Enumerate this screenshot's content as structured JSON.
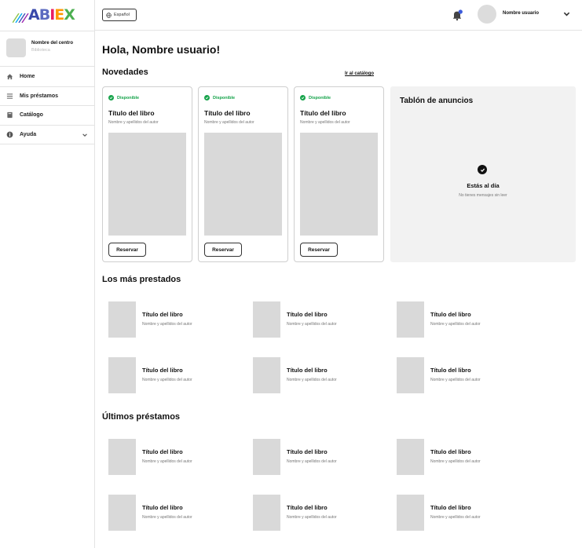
{
  "brand": {
    "logo_text": "ABIEX"
  },
  "center": {
    "name": "Nombre del centro",
    "type": "Biblioteca"
  },
  "sidebar": {
    "items": [
      {
        "label": "Home",
        "icon": "home-icon"
      },
      {
        "label": "Mis préstamos",
        "icon": "list-icon"
      },
      {
        "label": "Catálogo",
        "icon": "book-icon"
      },
      {
        "label": "Ayuda",
        "icon": "info-icon"
      }
    ]
  },
  "topbar": {
    "language": "Español",
    "user_name": "Nombre usuario"
  },
  "main": {
    "greeting": "Hola, Nombre usuario!",
    "novedades": {
      "title": "Novedades",
      "link": "Ir al catálogo",
      "cards": [
        {
          "status": "Disponible",
          "title": "Título del libro",
          "author": "Nombre y apellidos del autor",
          "button": "Reservar"
        },
        {
          "status": "Disponible",
          "title": "Título del libro",
          "author": "Nombre y apellidos del autor",
          "button": "Reservar"
        },
        {
          "status": "Disponible",
          "title": "Título del libro",
          "author": "Nombre y apellidos del autor",
          "button": "Reservar"
        }
      ]
    },
    "board": {
      "title": "Tablón de anuncios",
      "status": "Estás al día",
      "message": "No tienes mensajes sin leer"
    },
    "most_borrowed": {
      "title": "Los más prestados",
      "books": [
        {
          "title": "Título del libro",
          "author": "Nombre y apellidos del autor"
        },
        {
          "title": "Título del libro",
          "author": "Nombre y apellidos del autor"
        },
        {
          "title": "Título del libro",
          "author": "Nombre y apellidos del autor"
        },
        {
          "title": "Título del libro",
          "author": "Nombre y apellidos del autor"
        },
        {
          "title": "Título del libro",
          "author": "Nombre y apellidos del autor"
        },
        {
          "title": "Título del libro",
          "author": "Nombre y apellidos del autor"
        }
      ]
    },
    "recent_loans": {
      "title": "Últimos préstamos",
      "books": [
        {
          "title": "Título del libro",
          "author": "Nombre y apellidos del autor"
        },
        {
          "title": "Título del libro",
          "author": "Nombre y apellidos del autor"
        },
        {
          "title": "Título del libro",
          "author": "Nombre y apellidos del autor"
        },
        {
          "title": "Título del libro",
          "author": "Nombre y apellidos del autor"
        },
        {
          "title": "Título del libro",
          "author": "Nombre y apellidos del autor"
        },
        {
          "title": "Título del libro",
          "author": "Nombre y apellidos del autor"
        }
      ]
    }
  },
  "colors": {
    "available": "#16a34a",
    "notification": "#3b5bdb",
    "placeholder": "#d9d9d9",
    "board_bg": "#f2f2f2"
  }
}
